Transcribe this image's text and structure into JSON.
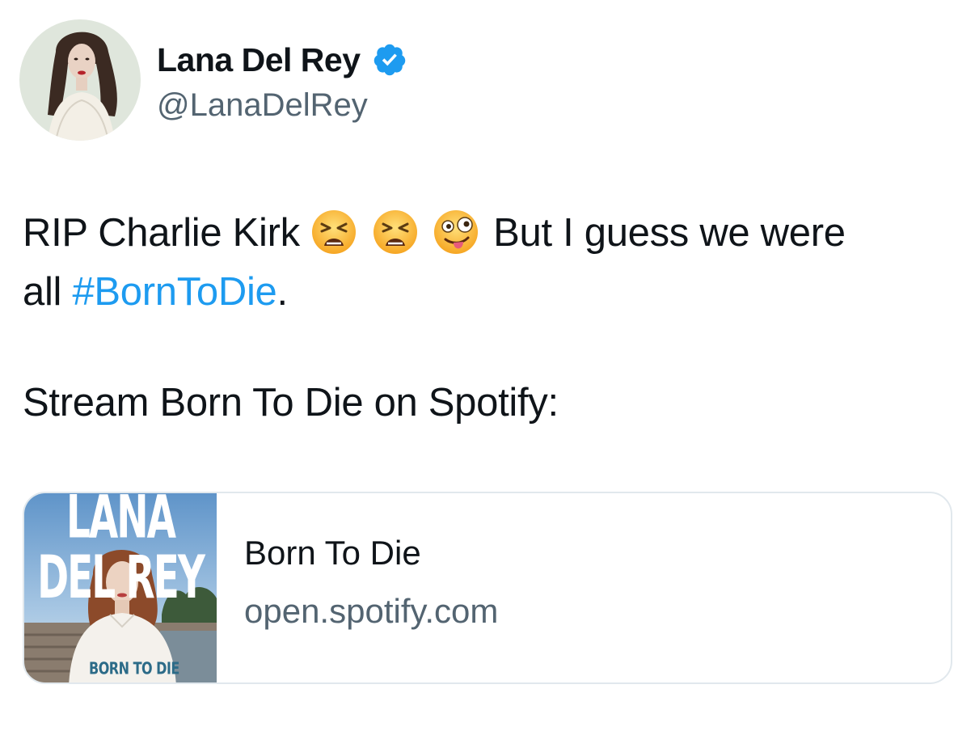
{
  "author": {
    "display_name": "Lana Del Rey",
    "handle": "@LanaDelRey",
    "verified": true,
    "verified_badge_color": "#1d9bf0"
  },
  "tweet": {
    "line1_text": "RIP Charlie Kirk",
    "emojis": [
      "tired-face-emoji",
      "tired-face-emoji",
      "zany-face-emoji"
    ],
    "line1_after_emojis": "But I guess we were",
    "line2_prefix": "all",
    "hashtag": "#BornToDie",
    "line2_suffix": ".",
    "stream_text": "Stream Born To Die on Spotify:"
  },
  "link_card": {
    "title": "Born To Die",
    "domain": "open.spotify.com",
    "cover_artist_text": "LANA DEL REY",
    "cover_album_text": "BORN TO DIE"
  },
  "colors": {
    "text_primary": "#0f1419",
    "text_secondary": "#536471",
    "link": "#1d9bf0",
    "card_border": "#e1e8ed"
  }
}
